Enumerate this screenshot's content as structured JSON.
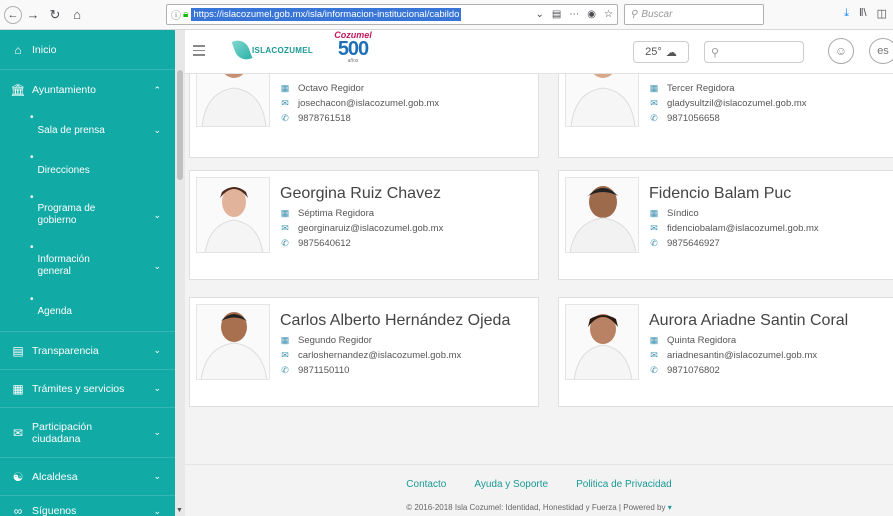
{
  "browser": {
    "url": "https://islacozumel.gob.mx/isla/informacion-institucional/cabildo",
    "search_placeholder": "Buscar"
  },
  "sidebar": {
    "items": [
      {
        "label": "Inicio",
        "icon": "home-icon"
      },
      {
        "label": "Ayuntamiento",
        "icon": "building-icon"
      },
      {
        "label": "Sala de prensa"
      },
      {
        "label": "Direcciones"
      },
      {
        "label": "Programa de gobierno"
      },
      {
        "label": "Información general"
      },
      {
        "label": "Agenda"
      },
      {
        "label": "Transparencia",
        "icon": "chart-icon"
      },
      {
        "label": "Trámites y servicios",
        "icon": "form-icon"
      },
      {
        "label": "Participación ciudadana",
        "icon": "megaphone-icon"
      },
      {
        "label": "Alcaldesa",
        "icon": "people-icon"
      },
      {
        "label": "Síguenos",
        "icon": "share-icon"
      }
    ],
    "sub": {
      "prensa_1": "Sala de prensa",
      "programa_1": "Programa de",
      "programa_2": "gobierno",
      "info_1": "Información",
      "info_2": "general",
      "part_1": "Participación",
      "part_2": "ciudadana"
    }
  },
  "header": {
    "logo_text": "ISLACOZUMEL",
    "logo2_top": "Cozumel",
    "logo2_num": "500",
    "logo2_bottom": "años",
    "temperature": "25°"
  },
  "members": [
    {
      "name": "",
      "role": "Octavo Regidor",
      "email": "josechacon@islacozumel.gob.mx",
      "phone": "9878761518"
    },
    {
      "name": "",
      "role": "Tercer Regidora",
      "email": "gladysultzil@islacozumel.gob.mx",
      "phone": "9871056658"
    },
    {
      "name": "Georgina Ruiz Chavez",
      "role": "Séptima Regidora",
      "email": "georginaruiz@islacozumel.gob.mx",
      "phone": "9875640612"
    },
    {
      "name": "Fidencio Balam Puc",
      "role": "Síndico",
      "email": "fidenciobalam@islacozumel.gob.mx",
      "phone": "9875646927"
    },
    {
      "name": "Carlos Alberto Hernández Ojeda",
      "role": "Segundo Regidor",
      "email": "carloshernandez@islacozumel.gob.mx",
      "phone": "9871150110"
    },
    {
      "name": "Aurora Ariadne Santin Coral",
      "role": "Quinta Regidora",
      "email": "ariadnesantin@islacozumel.gob.mx",
      "phone": "9871076802"
    }
  ],
  "footer": {
    "links": [
      "Contacto",
      "Ayuda y Soporte",
      "Politica de Privacidad"
    ],
    "copyright": "© 2016-2018 Isla Cozumel: Identidad, Honestidad y Fuerza | Powered by"
  },
  "colors": {
    "sidebar": "#12aaa5",
    "link": "#1a9a95"
  }
}
